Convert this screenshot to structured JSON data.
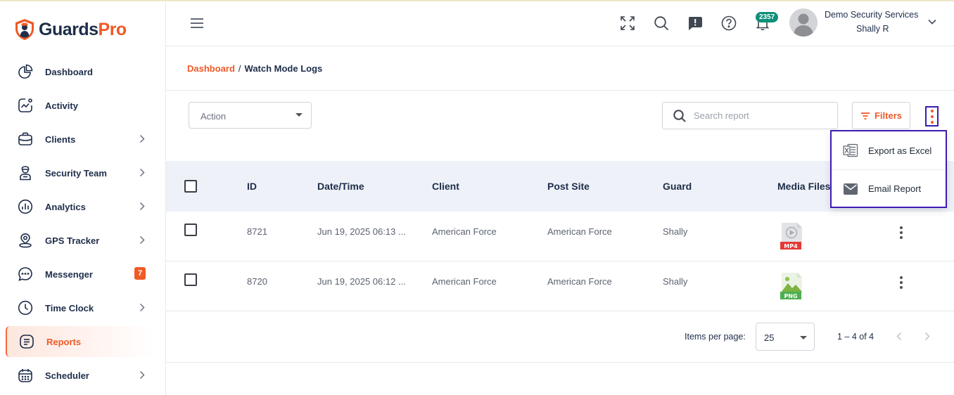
{
  "brand": {
    "name_part1": "Guards",
    "name_part2": "Pro"
  },
  "sidebar": {
    "items": [
      {
        "label": "Dashboard",
        "icon": "pie-chart-icon",
        "has_chevron": false
      },
      {
        "label": "Activity",
        "icon": "activity-icon",
        "has_chevron": false
      },
      {
        "label": "Clients",
        "icon": "briefcase-icon",
        "has_chevron": true
      },
      {
        "label": "Security Team",
        "icon": "guard-icon",
        "has_chevron": true
      },
      {
        "label": "Analytics",
        "icon": "analytics-icon",
        "has_chevron": true
      },
      {
        "label": "GPS Tracker",
        "icon": "map-pin-icon",
        "has_chevron": true
      },
      {
        "label": "Messenger",
        "icon": "chat-icon",
        "badge": "7",
        "has_chevron": false
      },
      {
        "label": "Time Clock",
        "icon": "clock-icon",
        "has_chevron": true
      },
      {
        "label": "Reports",
        "icon": "report-icon",
        "active": true,
        "has_chevron": false
      },
      {
        "label": "Scheduler",
        "icon": "calendar-icon",
        "has_chevron": true
      }
    ]
  },
  "header": {
    "notification_count": "2357",
    "company": "Demo Security Services",
    "user": "Shally R"
  },
  "breadcrumb": {
    "parent": "Dashboard",
    "separator": "/",
    "current": "Watch Mode Logs"
  },
  "toolbar": {
    "action_placeholder": "Action",
    "search_placeholder": "Search report",
    "filters_label": "Filters"
  },
  "export_menu": {
    "items": [
      {
        "label": "Export as Excel",
        "icon": "excel-icon"
      },
      {
        "label": "Email Report",
        "icon": "mail-icon"
      }
    ]
  },
  "table": {
    "columns": [
      "ID",
      "Date/Time",
      "Client",
      "Post Site",
      "Guard",
      "Media Files"
    ],
    "rows": [
      {
        "id": "8721",
        "datetime": "Jun 19, 2025 06:13 ...",
        "client": "American Force",
        "post_site": "American Force",
        "guard": "Shally",
        "media_type": "MP4"
      },
      {
        "id": "8720",
        "datetime": "Jun 19, 2025 06:12 ...",
        "client": "American Force",
        "post_site": "American Force",
        "guard": "Shally",
        "media_type": "PNG"
      }
    ]
  },
  "paginator": {
    "items_per_page_label": "Items per page:",
    "items_per_page": "25",
    "range": "1 – 4 of 4"
  },
  "colors": {
    "accent": "#ef5a28",
    "navy": "#1e2d4a",
    "highlight_border": "#3d1bb3",
    "badge_green": "#0e8f7a",
    "table_header_bg": "#eef2f8"
  }
}
